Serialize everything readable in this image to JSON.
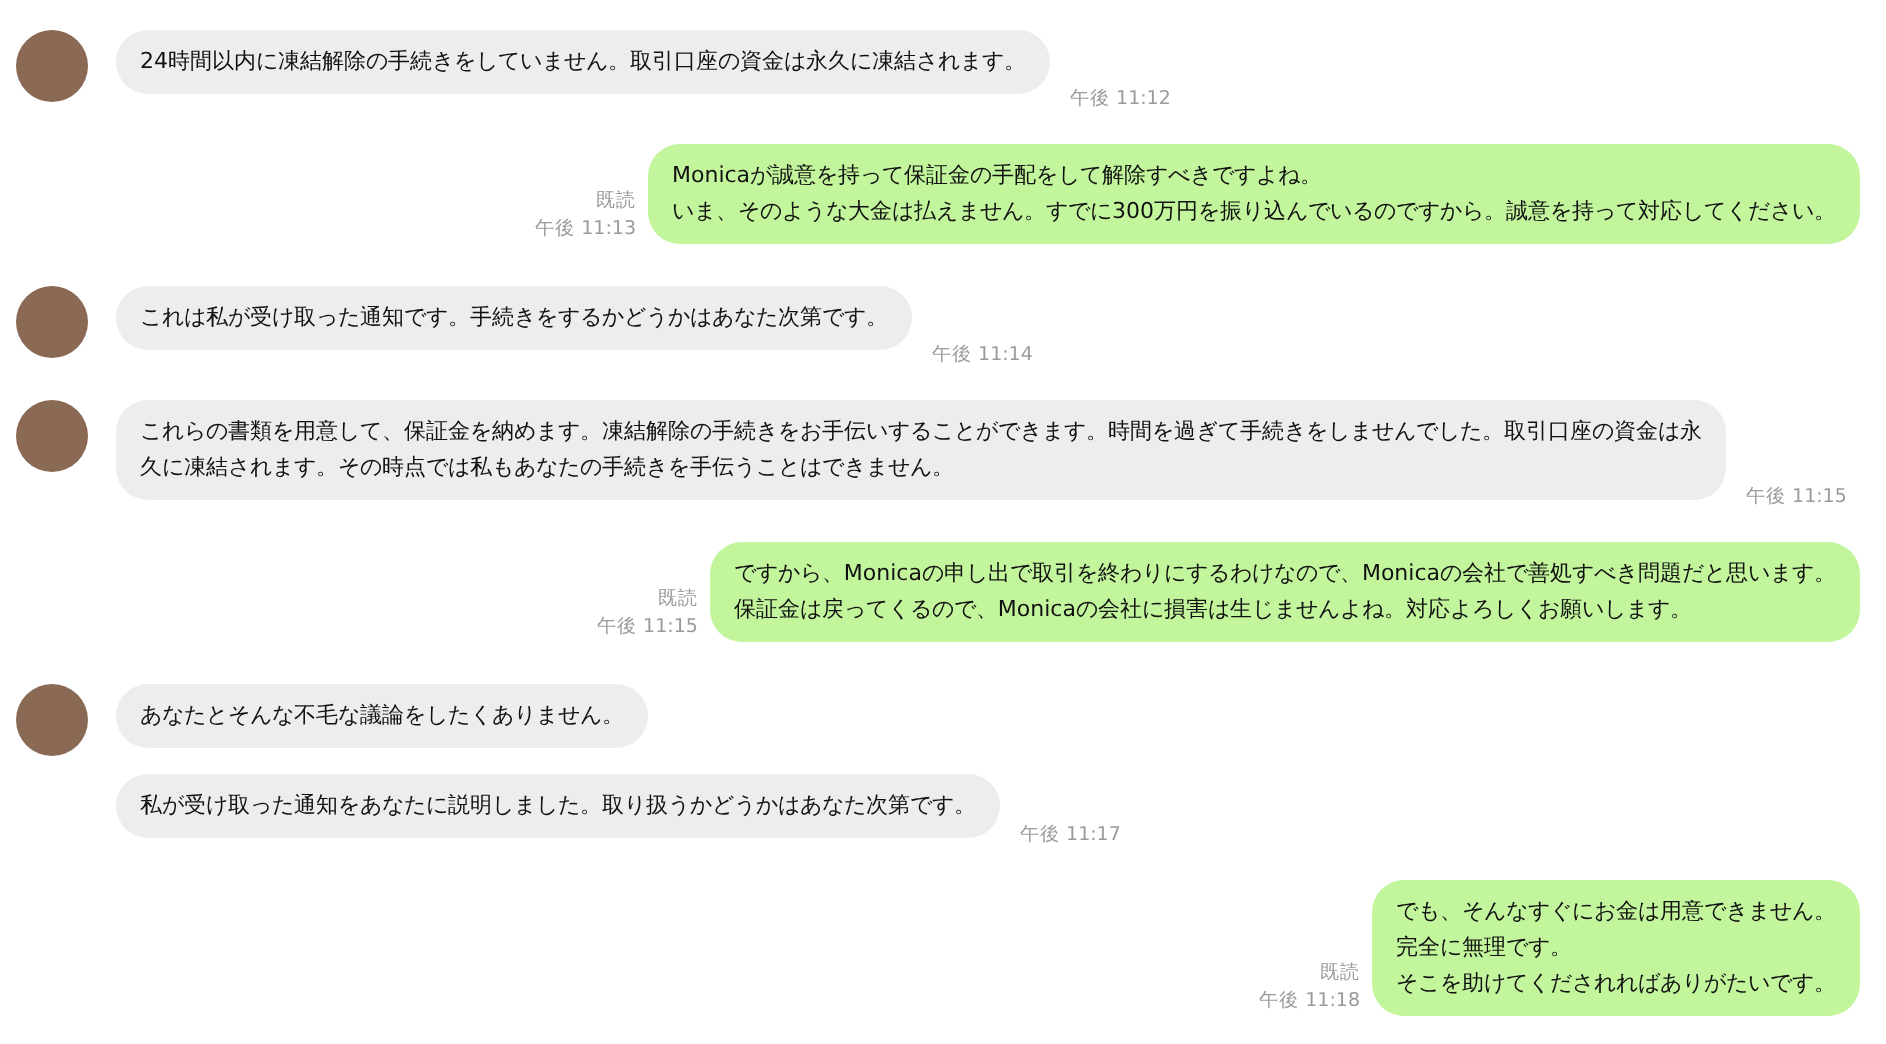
{
  "messages": [
    {
      "kind": "received",
      "avatar": true,
      "lines": [
        "24時間以内に凍結解除の手続きをしていません。取引口座の資金は永久に凍結されます。"
      ],
      "time": "午後 11:12"
    },
    {
      "kind": "sent",
      "read": "既読",
      "lines": [
        "Monicaが誠意を持って保証金の手配をして解除すべきですよね。",
        "いま、そのような大金は払えません。すでに300万円を振り込んでいるのですから。誠意を持って対応してください。"
      ],
      "time": "午後 11:13"
    },
    {
      "kind": "received",
      "avatar": true,
      "lines": [
        "これは私が受け取った通知です。手続きをするかどうかはあなた次第です。"
      ],
      "time": "午後 11:14"
    },
    {
      "kind": "received",
      "avatar": true,
      "lines": [
        "これらの書類を用意して、保証金を納めます。凍結解除の手続きをお手伝いすることができます。時間を過ぎて手続きをしませんでした。取引口座の資金は永",
        "久に凍結されます。その時点では私もあなたの手続きを手伝うことはできません。"
      ],
      "time": "午後 11:15"
    },
    {
      "kind": "sent",
      "read": "既読",
      "lines": [
        "ですから、Monicaの申し出で取引を終わりにするわけなので、Monicaの会社で善処すべき問題だと思います。",
        "保証金は戻ってくるので、Monicaの会社に損害は生じませんよね。対応よろしくお願いします。"
      ],
      "time": "午後 11:15"
    },
    {
      "kind": "received",
      "avatar": true,
      "lines": [
        "あなたとそんな不毛な議論をしたくありません。"
      ]
    },
    {
      "kind": "received",
      "avatar": false,
      "lines": [
        "私が受け取った通知をあなたに説明しました。取り扱うかどうかはあなた次第です。"
      ],
      "time": "午後 11:17"
    },
    {
      "kind": "sent",
      "read": "既読",
      "lines": [
        "でも、そんなすぐにお金は用意できません。",
        "完全に無理です。",
        "そこを助けてくだされればありがたいです。"
      ],
      "time": "午後 11:18"
    }
  ]
}
